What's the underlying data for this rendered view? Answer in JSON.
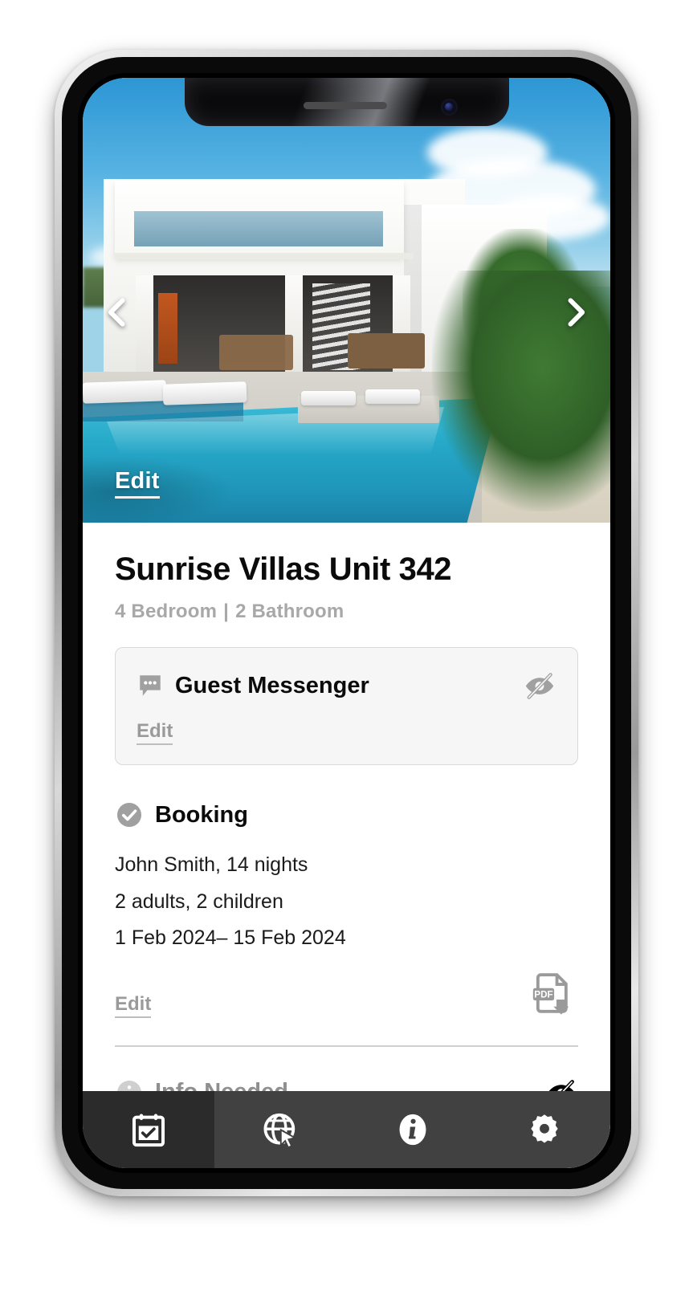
{
  "device": {
    "notch_elements": [
      "speaker-grille",
      "front-camera"
    ]
  },
  "hero": {
    "image_alt": "Modern white villa with swimming pool",
    "prev_icon": "chevron-left-icon",
    "next_icon": "chevron-right-icon",
    "edit_label": "Edit"
  },
  "property": {
    "title": "Sunrise Villas Unit 342",
    "bedrooms": "4 Bedroom",
    "separator": "|",
    "bathrooms": "2 Bathroom"
  },
  "messenger_card": {
    "icon": "chat-bubble-icon",
    "title": "Guest Messenger",
    "visibility_icon": "eye-slash-icon",
    "edit_label": "Edit"
  },
  "booking": {
    "icon": "check-circle-icon",
    "title": "Booking",
    "lines": [
      "John Smith, 14 nights",
      "2 adults, 2 children",
      "1 Feb 2024– 15 Feb 2024"
    ],
    "edit_label": "Edit",
    "download_icon": "pdf-download-icon",
    "download_badge": "PDF"
  },
  "info_needed": {
    "icon": "info-circle-icon",
    "title": "Info Needed",
    "visibility_icon": "eye-slash-icon"
  },
  "nav": {
    "items": [
      {
        "icon": "calendar-check-icon",
        "name": "nav-calendar",
        "active": true
      },
      {
        "icon": "globe-cursor-icon",
        "name": "nav-web",
        "active": false
      },
      {
        "icon": "info-icon",
        "name": "nav-info",
        "active": false
      },
      {
        "icon": "gear-icon",
        "name": "nav-settings",
        "active": false
      }
    ]
  },
  "colors": {
    "card_bg": "#f6f6f6",
    "card_border": "#d9d9d9",
    "muted_text": "#a8a8a8",
    "nav_bg": "#414141",
    "nav_active_bg": "#2b2b2b",
    "accent_text": "#0b0b0b"
  }
}
